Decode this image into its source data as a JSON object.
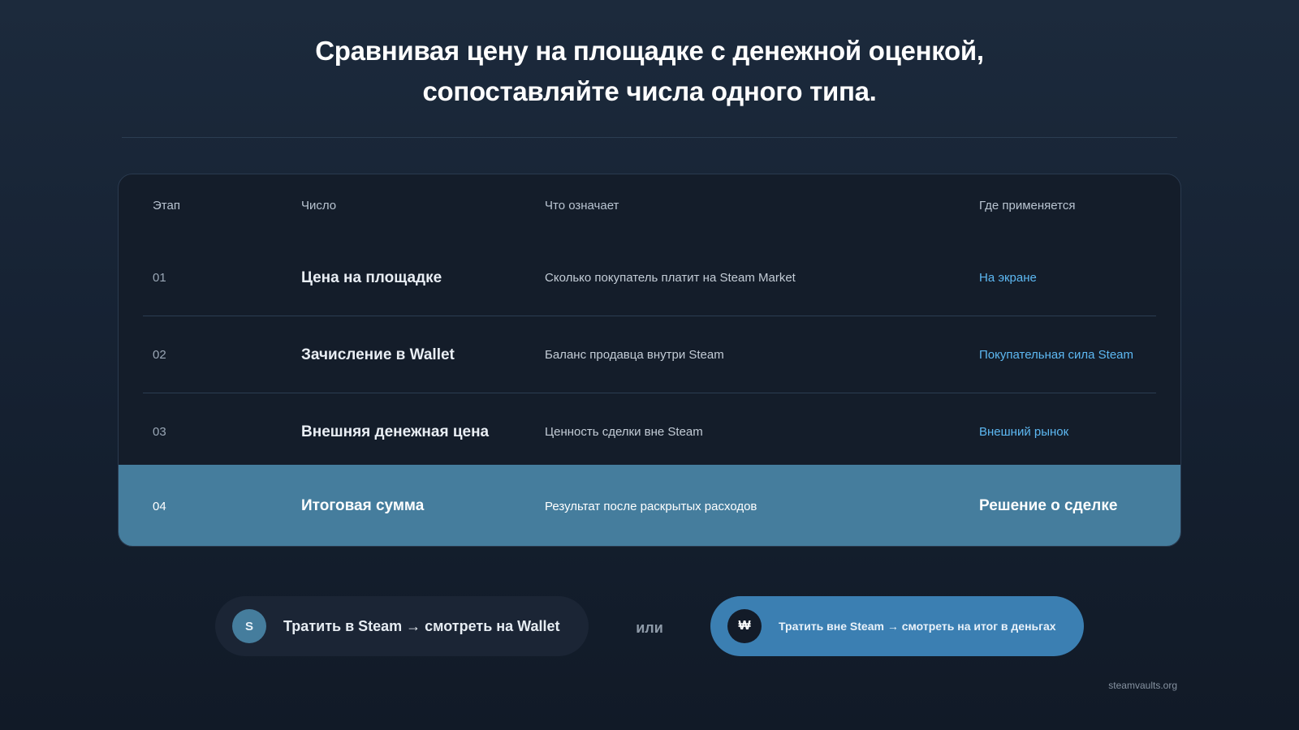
{
  "headline": {
    "line1": "Сравнивая цену на площадке с денежной оценкой,",
    "line2": "сопоставляйте числа одного типа."
  },
  "table": {
    "headers": {
      "step": "Этап",
      "number": "Число",
      "meaning": "Что означает",
      "where": "Где применяется"
    },
    "rows": [
      {
        "step": "01",
        "number": "Цена на площадке",
        "meaning": "Сколько покупатель платит на Steam Market",
        "where": "На экране"
      },
      {
        "step": "02",
        "number": "Зачисление в Wallet",
        "meaning": "Баланс продавца внутри Steam",
        "where": "Покупательная сила Steam"
      },
      {
        "step": "03",
        "number": "Внешняя денежная цена",
        "meaning": "Ценность сделки вне Steam",
        "where": "Внешний рынок"
      },
      {
        "step": "04",
        "number": "Итоговая сумма",
        "meaning": "Результат после раскрытых расходов",
        "where": "Решение о сделке"
      }
    ]
  },
  "choices": {
    "steam": {
      "badge": "S",
      "label": "Тратить в Steam → смотреть на Wallet"
    },
    "or": "или",
    "money": {
      "badge": "₩",
      "label": "Тратить вне Steam → смотреть на итог в деньгах"
    }
  },
  "footer": {
    "site": "steamvaults.org"
  },
  "colors": {
    "accent_link": "#5db8f2",
    "highlight_row": "#457d9d",
    "pill_money": "#3b7fb2"
  }
}
